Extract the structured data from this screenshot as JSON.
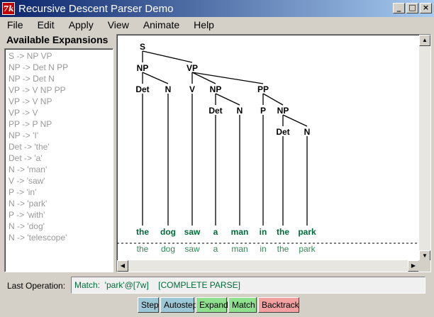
{
  "window": {
    "title": "Recursive Descent Parser Demo",
    "icon_label": "7k"
  },
  "menu": [
    "File",
    "Edit",
    "Apply",
    "View",
    "Animate",
    "Help"
  ],
  "expansions": {
    "title": "Available Expansions",
    "items": [
      "S -> NP VP",
      "NP -> Det N PP",
      "NP -> Det N",
      "VP -> V NP PP",
      "VP -> V NP",
      "VP -> V",
      "PP -> P NP",
      "NP -> 'I'",
      "Det -> 'the'",
      "Det -> 'a'",
      "N -> 'man'",
      "V -> 'saw'",
      "P -> 'in'",
      "N -> 'park'",
      "P -> 'with'",
      "N -> 'dog'",
      "N -> 'telescope'"
    ]
  },
  "tree": {
    "nodes": [
      {
        "id": "s",
        "label": "S",
        "parent": null
      },
      {
        "id": "np1",
        "label": "NP",
        "parent": "s"
      },
      {
        "id": "vp",
        "label": "VP",
        "parent": "s"
      },
      {
        "id": "det1",
        "label": "Det",
        "parent": "np1"
      },
      {
        "id": "n1",
        "label": "N",
        "parent": "np1"
      },
      {
        "id": "v",
        "label": "V",
        "parent": "vp"
      },
      {
        "id": "np2",
        "label": "NP",
        "parent": "vp"
      },
      {
        "id": "pp",
        "label": "PP",
        "parent": "vp"
      },
      {
        "id": "det2",
        "label": "Det",
        "parent": "np2"
      },
      {
        "id": "n2",
        "label": "N",
        "parent": "np2"
      },
      {
        "id": "p",
        "label": "P",
        "parent": "pp"
      },
      {
        "id": "np3",
        "label": "NP",
        "parent": "pp"
      },
      {
        "id": "det3",
        "label": "Det",
        "parent": "np3"
      },
      {
        "id": "n3",
        "label": "N",
        "parent": "np3"
      }
    ],
    "leaves": [
      {
        "word": "the",
        "parent": "det1"
      },
      {
        "word": "dog",
        "parent": "n1"
      },
      {
        "word": "saw",
        "parent": "v"
      },
      {
        "word": "a",
        "parent": "det2"
      },
      {
        "word": "man",
        "parent": "n2"
      },
      {
        "word": "in",
        "parent": "p"
      },
      {
        "word": "the",
        "parent": "det3"
      },
      {
        "word": "park",
        "parent": "n3"
      }
    ],
    "text_tokens": [
      "the",
      "dog",
      "saw",
      "a",
      "man",
      "in",
      "the",
      "park"
    ]
  },
  "colors": {
    "node": "#000000",
    "leaf": "#006b3a",
    "token": "#2e8b57",
    "divider": "#000000"
  },
  "status": {
    "label": "Last Operation:",
    "value": "Match:  'park'@[7w]    [COMPLETE PARSE]"
  },
  "buttons": {
    "step": "Step",
    "autostep": "Autostep",
    "expand": "Expand",
    "match": "Match",
    "backtrack": "Backtrack"
  }
}
